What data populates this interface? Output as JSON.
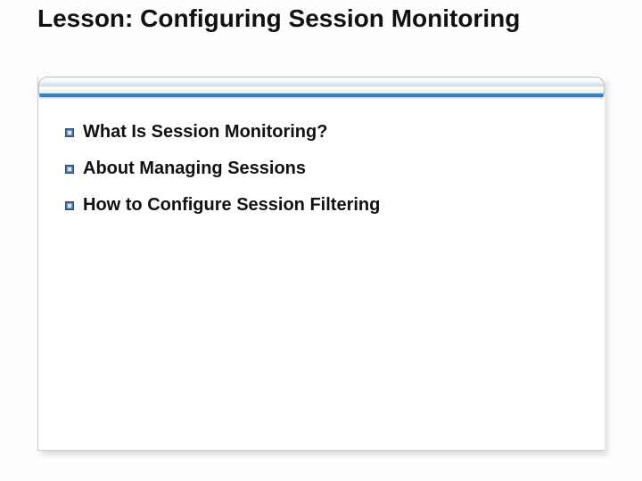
{
  "title": "Lesson: Configuring Session Monitoring",
  "bullets": [
    {
      "text": "What Is Session Monitoring?"
    },
    {
      "text": "About Managing Sessions"
    },
    {
      "text": "How to Configure Session Filtering"
    }
  ]
}
